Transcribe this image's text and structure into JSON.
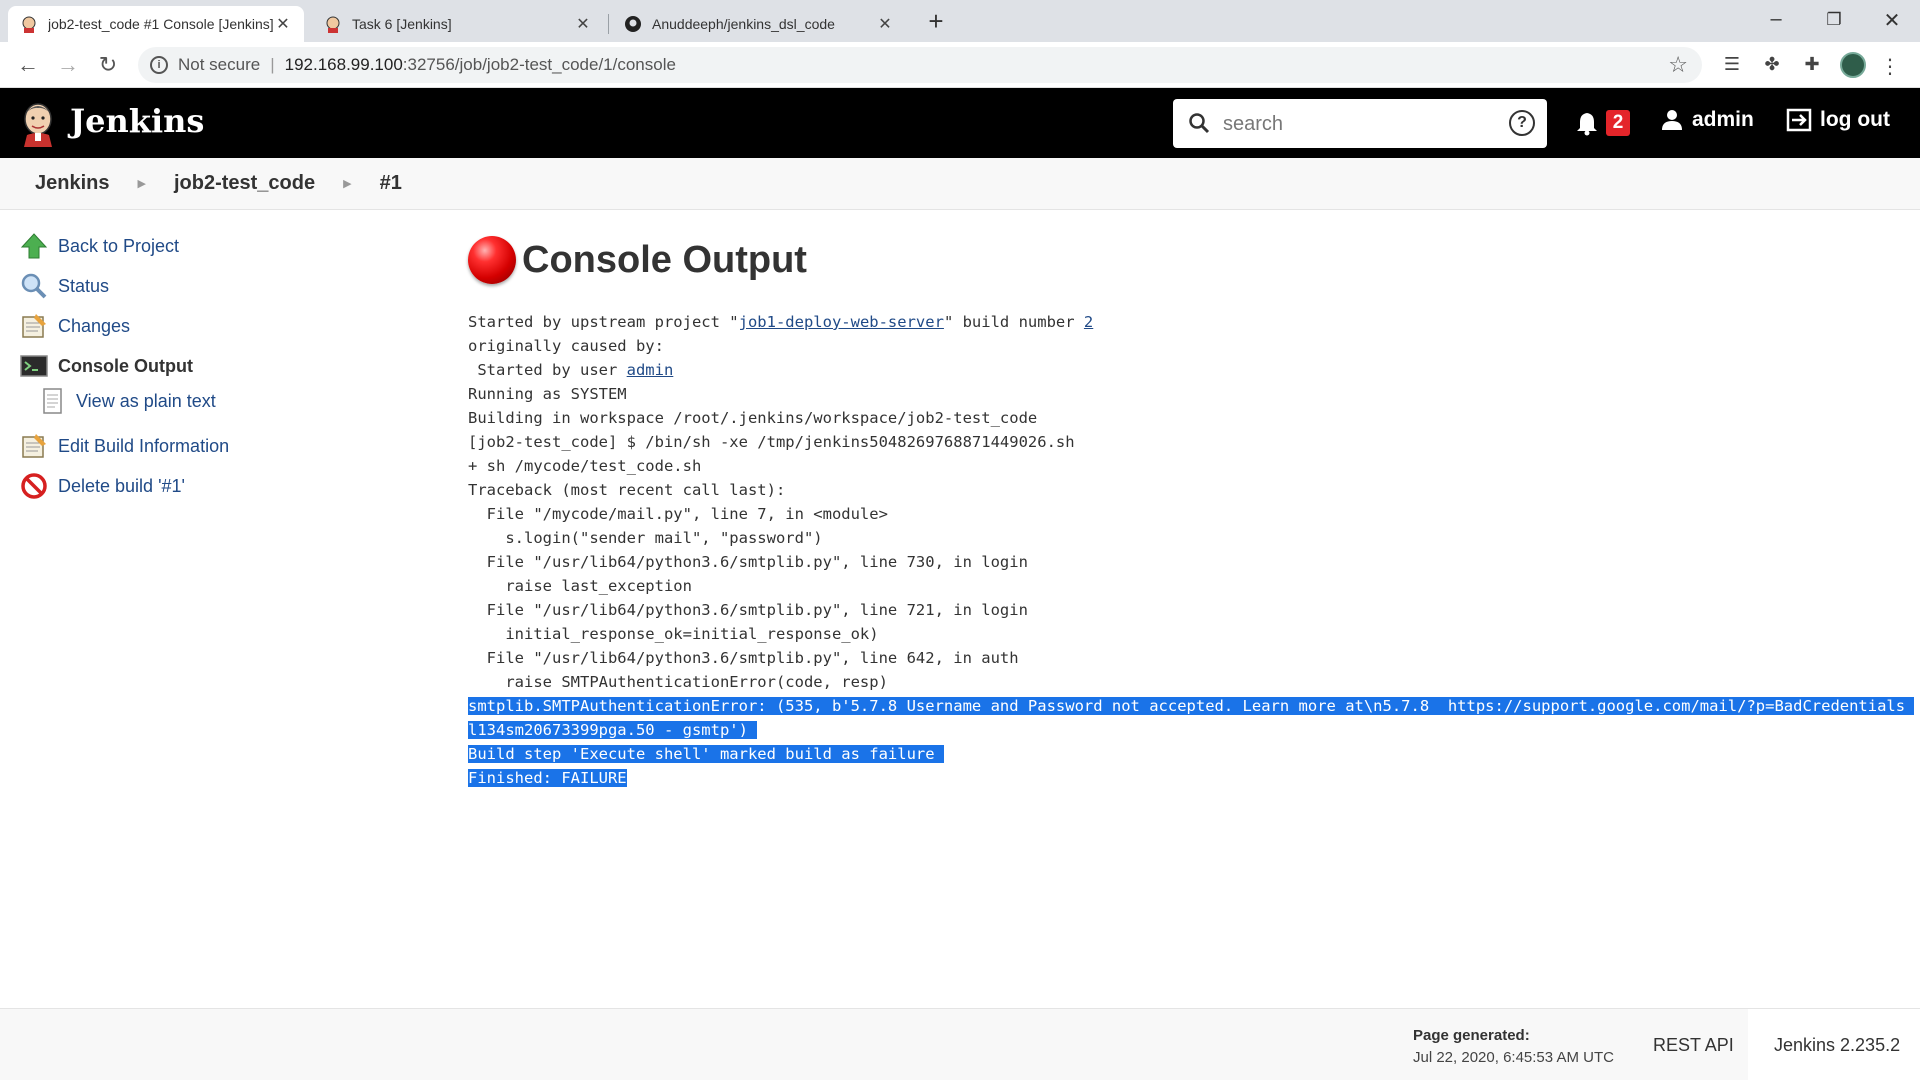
{
  "browser": {
    "tabs": [
      {
        "title": "job2-test_code #1 Console [Jenkins]",
        "active": true
      },
      {
        "title": "Task 6 [Jenkins]",
        "active": false
      },
      {
        "title": "Anuddeeph/jenkins_dsl_code",
        "active": false
      }
    ],
    "address": {
      "security_label": "Not secure",
      "url_host": "192.168.99.100",
      "url_rest": ":32756/job/job2-test_code/1/console"
    }
  },
  "header": {
    "brand": "Jenkins",
    "search_placeholder": "search",
    "notification_count": "2",
    "user": "admin",
    "logout": "log out"
  },
  "breadcrumb": [
    "Jenkins",
    "job2-test_code",
    "#1"
  ],
  "sidebar": {
    "items": [
      {
        "label": "Back to Project",
        "icon": "up-arrow-icon"
      },
      {
        "label": "Status",
        "icon": "magnifier-icon"
      },
      {
        "label": "Changes",
        "icon": "notepad-icon"
      },
      {
        "label": "Console Output",
        "icon": "terminal-icon"
      },
      {
        "label": "View as plain text",
        "icon": "document-icon"
      },
      {
        "label": "Edit Build Information",
        "icon": "notepad-icon"
      },
      {
        "label": "Delete build '#1'",
        "icon": "no-entry-icon"
      }
    ]
  },
  "main": {
    "title": "Console Output",
    "status": "failed",
    "console": {
      "line1_prefix": "Started by upstream project \"",
      "upstream_project": "job1-deploy-web-server",
      "line1_mid": "\" build number ",
      "build_number": "2",
      "line2": "originally caused by:",
      "line3_prefix": " Started by user ",
      "user_link": "admin",
      "lines": [
        "Running as SYSTEM",
        "Building in workspace /root/.jenkins/workspace/job2-test_code",
        "[job2-test_code] $ /bin/sh -xe /tmp/jenkins5048269768871449026.sh",
        "+ sh /mycode/test_code.sh",
        "Traceback (most recent call last):",
        "  File \"/mycode/mail.py\", line 7, in <module>",
        "    s.login(\"sender mail\", \"password\")",
        "  File \"/usr/lib64/python3.6/smtplib.py\", line 730, in login",
        "    raise last_exception",
        "  File \"/usr/lib64/python3.6/smtplib.py\", line 721, in login",
        "    initial_response_ok=initial_response_ok)",
        "  File \"/usr/lib64/python3.6/smtplib.py\", line 642, in auth",
        "    raise SMTPAuthenticationError(code, resp)"
      ],
      "highlighted": [
        "smtplib.SMTPAuthenticationError: (535, b'5.7.8 Username and Password not accepted. Learn more at\\n5.7.8  https://support.google.com/mail/?p=BadCredentials ",
        "l134sm20673399pga.50 - gsmtp') ",
        "Build step 'Execute shell' marked build as failure ",
        "Finished: FAILURE"
      ]
    }
  },
  "footer": {
    "page_generated_label": "Page generated:",
    "page_generated_value": "Jul 22, 2020, 6:45:53 AM UTC",
    "rest_api": "REST API",
    "version": "Jenkins 2.235.2"
  },
  "colors": {
    "link": "#204a87",
    "header_bg": "#000000",
    "selection": "#1a73e8",
    "badge": "#e4252a"
  }
}
